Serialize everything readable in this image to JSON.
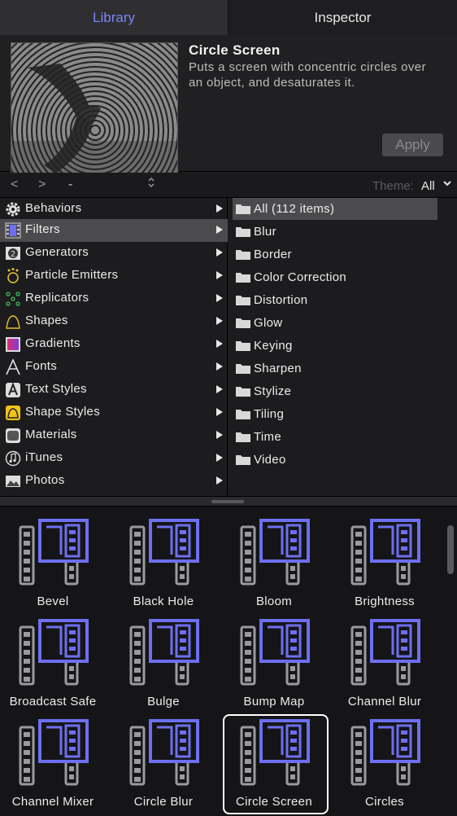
{
  "tabs": {
    "library": "Library",
    "inspector": "Inspector"
  },
  "preview": {
    "title": "Circle Screen",
    "description": "Puts a screen with concentric circles over an object, and desaturates it.",
    "apply_label": "Apply"
  },
  "nav": {
    "back": "<",
    "forward": ">",
    "path": "-",
    "theme_label": "Theme:",
    "theme_value": "All"
  },
  "categories": [
    {
      "label": "Behaviors",
      "icon": "gear-icon"
    },
    {
      "label": "Filters",
      "icon": "filmstrip-icon",
      "selected": true
    },
    {
      "label": "Generators",
      "icon": "generator-icon"
    },
    {
      "label": "Particle Emitters",
      "icon": "particle-icon"
    },
    {
      "label": "Replicators",
      "icon": "replicator-icon"
    },
    {
      "label": "Shapes",
      "icon": "shape-icon"
    },
    {
      "label": "Gradients",
      "icon": "gradient-icon"
    },
    {
      "label": "Fonts",
      "icon": "font-icon"
    },
    {
      "label": "Text Styles",
      "icon": "text-style-icon"
    },
    {
      "label": "Shape Styles",
      "icon": "shape-style-icon"
    },
    {
      "label": "Materials",
      "icon": "material-icon"
    },
    {
      "label": "iTunes",
      "icon": "music-icon"
    },
    {
      "label": "Photos",
      "icon": "photo-icon"
    }
  ],
  "folders": [
    {
      "label": "All (112 items)",
      "selected": true
    },
    {
      "label": "Blur"
    },
    {
      "label": "Border"
    },
    {
      "label": "Color Correction"
    },
    {
      "label": "Distortion"
    },
    {
      "label": "Glow"
    },
    {
      "label": "Keying"
    },
    {
      "label": "Sharpen"
    },
    {
      "label": "Stylize"
    },
    {
      "label": "Tiling"
    },
    {
      "label": "Time"
    },
    {
      "label": "Video"
    }
  ],
  "filters": [
    {
      "label": "Bevel"
    },
    {
      "label": "Black Hole"
    },
    {
      "label": "Bloom"
    },
    {
      "label": "Brightness"
    },
    {
      "label": "Broadcast Safe"
    },
    {
      "label": "Bulge"
    },
    {
      "label": "Bump Map"
    },
    {
      "label": "Channel Blur"
    },
    {
      "label": "Channel Mixer"
    },
    {
      "label": "Circle Blur"
    },
    {
      "label": "Circle Screen",
      "selected": true
    },
    {
      "label": "Circles"
    }
  ],
  "colors": {
    "accent": "#7a84f8",
    "filter_icon": "#6d6ff0",
    "selection": "#4b4b4e"
  }
}
